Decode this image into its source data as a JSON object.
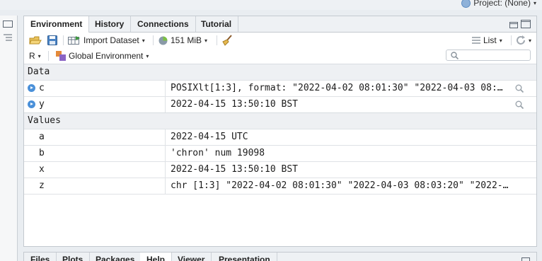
{
  "project": {
    "label": "Project: (None)"
  },
  "env_tabs": [
    {
      "label": "Environment",
      "active": true
    },
    {
      "label": "History"
    },
    {
      "label": "Connections"
    },
    {
      "label": "Tutorial"
    }
  ],
  "toolbar": {
    "import_label": "Import Dataset",
    "memory_label": "151 MiB",
    "view_label": "List"
  },
  "envbar": {
    "language": "R",
    "environment": "Global Environment"
  },
  "sections": {
    "data_label": "Data",
    "values_label": "Values"
  },
  "data_rows": [
    {
      "name": "c",
      "value": "POSIXlt[1:3], format: \"2022-04-02 08:01:30\" \"2022-04-03 08:…"
    },
    {
      "name": "y",
      "value": "2022-04-15 13:50:10 BST"
    }
  ],
  "value_rows": [
    {
      "name": "a",
      "value": "2022-04-15 UTC"
    },
    {
      "name": "b",
      "value": "'chron' num 19098"
    },
    {
      "name": "x",
      "value": "2022-04-15 13:50:10 BST"
    },
    {
      "name": "z",
      "value": "chr [1:3] \"2022-04-02 08:01:30\" \"2022-04-03 08:03:20\" \"2022-…"
    }
  ],
  "bottom_tabs": [
    {
      "label": "Files"
    },
    {
      "label": "Plots"
    },
    {
      "label": "Packages"
    },
    {
      "label": "Help",
      "active": true
    },
    {
      "label": "Viewer"
    },
    {
      "label": "Presentation"
    }
  ]
}
